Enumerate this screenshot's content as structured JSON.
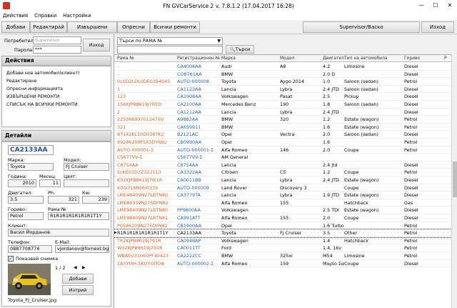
{
  "window": {
    "title": "FN GVCarService 2 v. 7.8.1.2 (17.04.2017 16:28)",
    "minimize": "—",
    "maximize": "☐",
    "close": "✕"
  },
  "menu": [
    "Действия",
    "Справки",
    "Настройки"
  ],
  "toolbar": {
    "add": "Добави",
    "edit": "Редактирай",
    "done_repairs": "Извършени ремонти",
    "options": "Опресни",
    "all_repairs": "Всички ремонти",
    "user_label": "Supervisor/Васко",
    "exit": "Изход"
  },
  "login": {
    "user_label": "Потребител:",
    "user_value": "Supervisor",
    "password_label": "Парола:",
    "password_value": "***",
    "exit_button": "Изход"
  },
  "actions": {
    "title": "Действия",
    "items": [
      "Добави нов автомобил(клиент)",
      "Редактиране",
      "Опресни информацията",
      "ИЗВЪРШЕНИ РЕМОНТИ",
      "СПИСЪК НА ВСИЧКИ РЕМОНТИ"
    ]
  },
  "details": {
    "title": "Детайли",
    "reg_no": "CA2133AA",
    "brand_label": "Марка:",
    "brand": "Toyota",
    "model_label": "Модел:",
    "model": "FJ Cruiser",
    "year_label": "Година:",
    "year": "2010",
    "month_label": "Месец:",
    "month": "11",
    "color_label": "Цвят:",
    "color": "",
    "engine_label": "Двигател:",
    "engine": "3.5",
    "hp_label": "Рh:",
    "hp": "321",
    "kw_label": "Кw:",
    "kw": "239",
    "fuel_label": "Гориво:",
    "fuel": "Petrol",
    "vin_label": "Рама №",
    "vin": "R1R1R1R1R1R1R1T1Y",
    "client_label": "Клиент:",
    "client": "Васил Йорданов",
    "phone_label": "Телефон:",
    "phone": "0887708774",
    "email_label": "E-Mail:",
    "email": "vjordanov@fornext.bg",
    "show_photo_label": "Показвай снимка",
    "photo_counter": "1 / 2",
    "photo_prev": "◀",
    "photo_next": "▶",
    "add_button": "Добави",
    "delete_button": "Изтрий",
    "photo_filename": "Toyota_FJ_Cruiser.jpg"
  },
  "search": {
    "mode": "Търси по РАМА №",
    "query": "",
    "button": "Търси"
  },
  "grid": {
    "headers": [
      "Рама №",
      "Регистрационен №",
      "Марка",
      "Модел",
      "Двигател",
      "Тип на автомобила",
      "Гориво",
      "Р"
    ],
    "rows": [
      [
        "-",
        "CA4004AA",
        "Audi",
        "A8",
        "4.2",
        "Limosine",
        "Diesel"
      ],
      [
        "-",
        "CO8761AA",
        "BMW",
        "",
        "2.0 D",
        "",
        "Diesel"
      ],
      [
        "0L0D2LDL0DE0354S45",
        "AUTO-000008",
        "Toyota",
        "Aygo 2014",
        "1.0",
        "Saloon (sedan)",
        "Petrol"
      ],
      [
        "1",
        "CA1122AA",
        "Lancia",
        "Lybra",
        "2.4 JTD",
        "Saloon (sedan)",
        "Diesel"
      ],
      [
        "123",
        "CA1908AA",
        "Volkswagen",
        "Pasat",
        "2.5",
        "Pickup",
        "Diesel"
      ],
      [
        "156KJPB8619J7RED",
        "CA2100AA",
        "Mercedes Benz",
        "190",
        "1.8",
        "Saloon (sedan)",
        "Diesel"
      ],
      [
        "2",
        "CA1212AA",
        "Lancia",
        "Lybra",
        "2.4 JTD",
        "",
        "Diesel"
      ],
      [
        "225566997012476V",
        "A9882AA",
        "BMW",
        "320",
        "1.2",
        "Estate (wagon)",
        "Petrol"
      ],
      [
        "321",
        "CA659911",
        "BMW",
        "",
        "1.6",
        "Estate (wagon)",
        "Petrol"
      ],
      [
        "87142KL10D0387K2",
        "B2121AC",
        "Opel",
        "Vectra",
        "2.0",
        "Saloon (sedan)",
        "Diesel"
      ],
      [
        "99286209FSX5DYNB2",
        "CB0990AA",
        "Opel",
        "",
        "1.6",
        "",
        "Petrol"
      ],
      [
        "AUTO-000001-Σ",
        "AUTO-000001-Σ",
        "Alfa Romeo",
        "146",
        "2.0",
        "Coupe",
        "Petrol"
      ],
      [
        "C5677VV-Σ",
        "C5677VV-Σ",
        "AM General",
        "",
        "",
        "",
        ""
      ],
      [
        "C8754AA",
        "C8754AA",
        "Lancia",
        "",
        "2.4 jtd",
        "",
        "Diesel"
      ],
      [
        "ELKE03D3Z322113",
        "CA3322AA",
        "Citroen",
        "C5",
        "1.2",
        "Coupe",
        "Petrol"
      ],
      [
        "K02KJPB8619J79I1R",
        "CA0011BB",
        "Lancia",
        "Lybra",
        "2.4 JTD",
        "Estate (wagon)",
        "Diesel"
      ],
      [
        "K0I9316R66I0339",
        "AUTO-000009",
        "Land Rover",
        "Discovery 3",
        "",
        "Coupe",
        "Diesel"
      ],
      [
        "LME98409N27LBTN80",
        "CA3779TA",
        "Lancia",
        "Lybra",
        "1.9 JTD",
        "Estate (wagon)",
        "Diesel"
      ],
      [
        "LME86339N275DYN82",
        "",
        "Alfa Romeo",
        "155",
        "",
        "Hatchback",
        "Gas"
      ],
      [
        "LME98409N27LBTN80",
        "PP9800AA",
        "Volkswagen",
        "",
        "2.5 TDI",
        "Estate (wagon)",
        "Diesel"
      ],
      [
        "LME98409N27LBTN81",
        "CA991ATT",
        "Alfa Romeo",
        "155",
        "2.0",
        "Coupe",
        "Diesel"
      ],
      [
        "P0586209N275DYN82",
        "CB1900AA",
        "Opel",
        "",
        "1.6 Turbo",
        "",
        "Petrol"
      ],
      [
        "R1R1R1R1R1R1R1T1Y",
        "CA2133AA",
        "Toyota",
        "FJ Cruiser",
        "3.5",
        "Other",
        "Petrol"
      ],
      [
        "TR2KJPB8619J791R",
        "CA0948AP",
        "Volkswagen",
        "",
        "1.4",
        "Hatchback",
        "Petrol"
      ],
      [
        "W02KJPB8619J791R",
        "CA0011TT",
        "Ford",
        "",
        "1.4, 16v",
        "",
        "Petrol"
      ],
      [
        "WBAEU31060PF40423",
        "CA2222CC",
        "BMW",
        "325xi",
        "M54",
        "Limosine",
        "Petrol"
      ],
      [
        "ΣΑΛΥΜΗ-ΣΚΟΥΟΠΟΦ",
        "AUTO-000002-Σ",
        "Alfa Romeo",
        "159",
        "Μαρίο Σα",
        "Coupe",
        "Diesel"
      ]
    ],
    "selected_index": 22
  },
  "colors": {
    "vin": "#e3601a",
    "reg": "#2060c0",
    "car_yellow": "#e8c020"
  }
}
